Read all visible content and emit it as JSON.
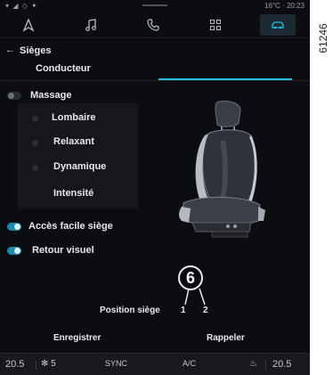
{
  "status": {
    "left": "▾ ◢ ◇ ✦",
    "right": "16°C · 20:23"
  },
  "nav": {
    "tabs": [
      "navigation-icon",
      "music-icon",
      "phone-icon",
      "apps-icon",
      "car-icon"
    ]
  },
  "header": {
    "back_icon": "←",
    "title": "Sièges",
    "subtab": "Conducteur"
  },
  "menu": {
    "massage": "Massage",
    "lombaire": "Lombaire",
    "relaxant": "Relaxant",
    "dynamique": "Dynamique",
    "intensite": "Intensité",
    "acces": "Accès facile siège",
    "retour": "Retour visuel"
  },
  "seat": {
    "position_label": "Position siège",
    "pos1": "1",
    "pos2": "2",
    "callout": "6"
  },
  "actions": {
    "save": "Enregistrer",
    "recall": "Rappeler"
  },
  "bottom": {
    "temp_left": "20.5",
    "fan": "5",
    "sync": "SYNC",
    "ac": "A/C",
    "temp_right": "20.5"
  },
  "document_id": "61246",
  "colors": {
    "accent": "#25bfe0",
    "background": "#0c0d10"
  }
}
